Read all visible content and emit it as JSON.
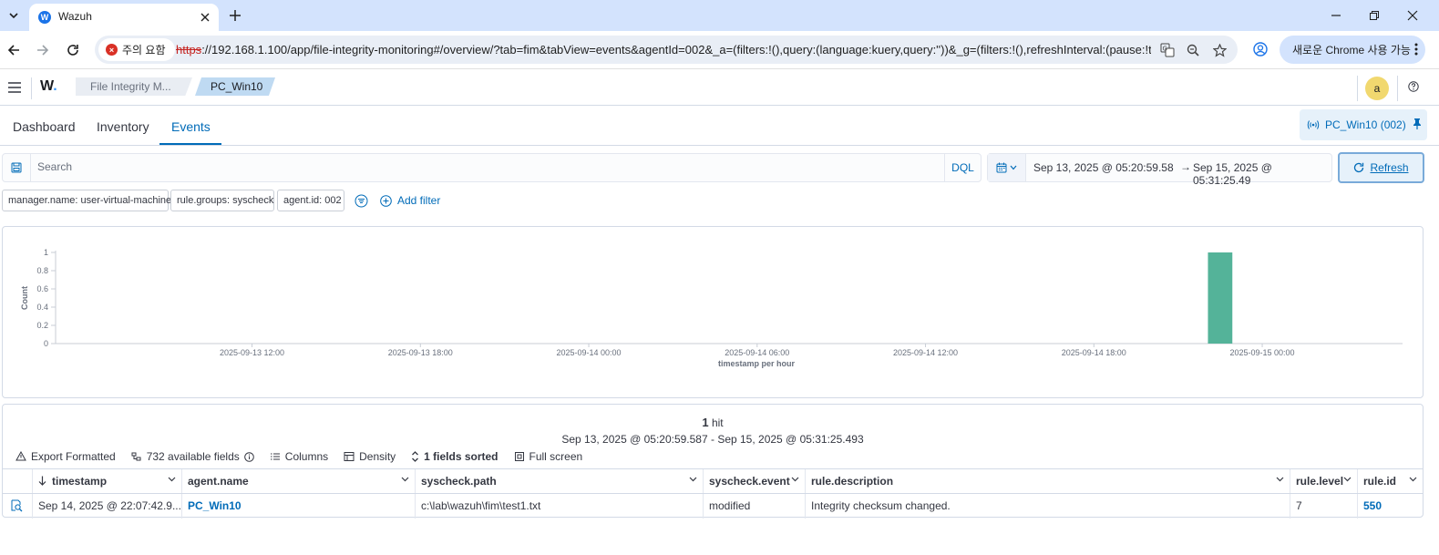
{
  "browser": {
    "tab_title": "Wazuh",
    "tab_favicon": "W",
    "security_warning": "주의 요함",
    "url_protocol": "https",
    "url_rest": "://192.168.1.100/app/file-integrity-monitoring#/overview/?tab=fim&tabView=events&agentId=002&_a=(filters:!(),query:(language:kuery,query:''))&_g=(filters:!(),refreshInterval:(pause:!t,val...",
    "update_label": "새로운 Chrome 사용 가능"
  },
  "app": {
    "logo": "W",
    "logo_dot": ".",
    "breadcrumbs": [
      "File Integrity M...",
      "PC_Win10"
    ],
    "avatar_initial": "a"
  },
  "tabs": [
    "Dashboard",
    "Inventory",
    "Events"
  ],
  "active_tab": "Events",
  "agent_badge": "PC_Win10 (002)",
  "query": {
    "placeholder": "Search",
    "language": "DQL"
  },
  "date_range": {
    "start": "Sep 13, 2025 @ 05:20:59.58",
    "arrow": "→",
    "end": "Sep 15, 2025 @ 05:31:25.49",
    "refresh_label": "Refresh"
  },
  "filters": [
    "manager.name: user-virtual-machine",
    "rule.groups: syscheck",
    "agent.id: 002"
  ],
  "add_filter_label": "Add filter",
  "chart_data": {
    "type": "bar",
    "xlabel": "timestamp per hour",
    "ylabel": "Count",
    "ylim": [
      0,
      1
    ],
    "y_ticks": [
      "0",
      "0.2",
      "0.4",
      "0.6",
      "0.8",
      "1"
    ],
    "x_tick_labels": [
      "2025-09-13 12:00",
      "2025-09-13 18:00",
      "2025-09-14 00:00",
      "2025-09-14 06:00",
      "2025-09-14 12:00",
      "2025-09-14 18:00",
      "2025-09-15 00:00"
    ],
    "x_range": [
      "2025-09-13 05:00",
      "2025-09-15 05:00"
    ],
    "bars": [
      {
        "x": "2025-09-14 22:00",
        "value": 1
      }
    ],
    "bar_color": "#54b399"
  },
  "results": {
    "hits_count": "1",
    "hits_label": "hit",
    "range_text": "Sep 13, 2025 @ 05:20:59.587 - Sep 15, 2025 @ 05:31:25.493",
    "toolbar": {
      "export": "Export Formatted",
      "fields": "732 available fields",
      "columns": "Columns",
      "density": "Density",
      "sorted": "1 fields sorted",
      "fullscreen": "Full screen"
    },
    "columns": [
      "timestamp",
      "agent.name",
      "syscheck.path",
      "syscheck.event",
      "rule.description",
      "rule.level",
      "rule.id"
    ],
    "rows": [
      [
        "Sep 14, 2025 @ 22:07:42.9...",
        "PC_Win10",
        "c:\\lab\\wazuh\\fim\\test1.txt",
        "modified",
        "Integrity checksum changed.",
        "7",
        "550"
      ]
    ]
  }
}
